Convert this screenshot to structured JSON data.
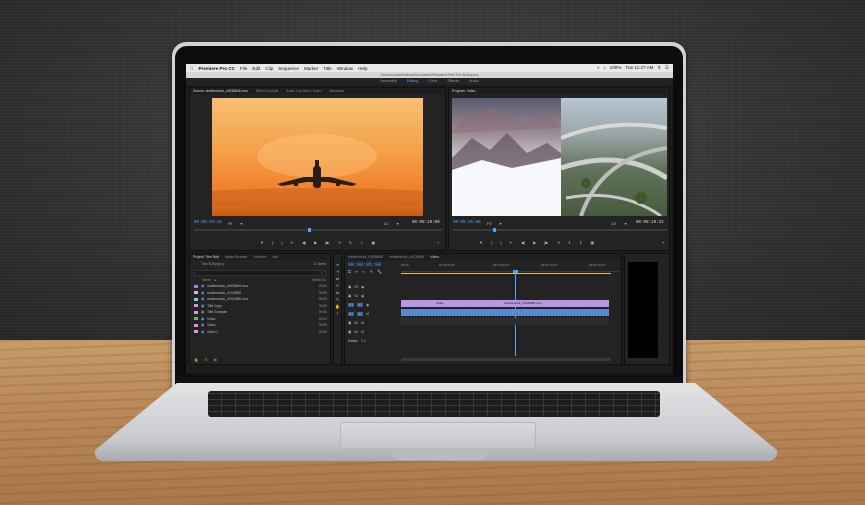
{
  "menubar": {
    "app": "Premiere Pro CC",
    "items": [
      "File",
      "Edit",
      "Clip",
      "Sequence",
      "Marker",
      "Title",
      "Window",
      "Help"
    ],
    "battery": "100%",
    "clock": "Tue 11:27 AM"
  },
  "titlebar": "/Users/Guest/Desktop/Documents/Premiere/Trim/Trim Buff.prproj",
  "workspaces": {
    "items": [
      "Assembly",
      "Editing",
      "Color",
      "Effects",
      "Audio"
    ],
    "active": "Editing"
  },
  "source": {
    "tabs": [
      "Source: shutterstock_v2638846.mov",
      "Effect Controls",
      "Audio Clip Mixer: Video",
      "Metadata"
    ],
    "timecode_left": "00:00:04:16",
    "fit": "Fit",
    "resolution": "1/2",
    "timecode_right": "00:00:10:00"
  },
  "program": {
    "tabs": [
      "Program: Video"
    ],
    "timecode_left": "00:00:05:08",
    "fit": "Fit",
    "resolution": "1/4",
    "timecode_right": "00:00:19:22"
  },
  "project": {
    "tabs": [
      "Project: Trim Buff",
      "Media Browser",
      "Libraries",
      "Info"
    ],
    "file": "Trim Buff.prproj",
    "count": "11 Items",
    "header_name": "Name",
    "header_rate": "Media Du",
    "items": [
      {
        "name": "shutterstock_v2638846.mov",
        "color": "#8e8ee8",
        "dur": "00:00"
      },
      {
        "name": "shutterstock_v3126800",
        "color": "#e7a6e5",
        "dur": "00:00"
      },
      {
        "name": "shutterstock_v3104050.mov",
        "color": "#7ad0d6",
        "dur": "00:00"
      },
      {
        "name": "Title Copy",
        "color": "#e58fe0",
        "dur": "00:00"
      },
      {
        "name": "Title Example",
        "color": "#e58fe0",
        "dur": "00:00"
      },
      {
        "name": "Video",
        "color": "#5bc05b",
        "dur": "00:00"
      },
      {
        "name": "Video",
        "color": "#e58fe0",
        "dur": "00:00"
      },
      {
        "name": "Video 2",
        "color": "#e58fe0",
        "dur": "00:00"
      }
    ]
  },
  "timeline": {
    "tabs": [
      "shutterstock_v2638846",
      "shutterstock_v3126800",
      "Video"
    ],
    "active_tab": "Video",
    "timecode": "00:00:05:08",
    "ruler": [
      "00:00",
      "00:00:04:29",
      "00:00:09:29",
      "00:00:14:29",
      "00:00:19:29"
    ],
    "tracks_video": [
      "V3",
      "V2",
      "V1"
    ],
    "tracks_audio": [
      "A1",
      "A2",
      "A3"
    ],
    "master": "Master",
    "master_value": "0.0",
    "clips": {
      "v1_a": "Video",
      "v1_b": "shutterstock_v3126800.mov"
    }
  },
  "colors": {
    "accent": "#4ea3ff",
    "clip_purple": "#b796e6",
    "clip_audio": "#5b8fd6",
    "sunset_top": "#f3a35a",
    "sunset_bottom": "#f27a2a"
  }
}
